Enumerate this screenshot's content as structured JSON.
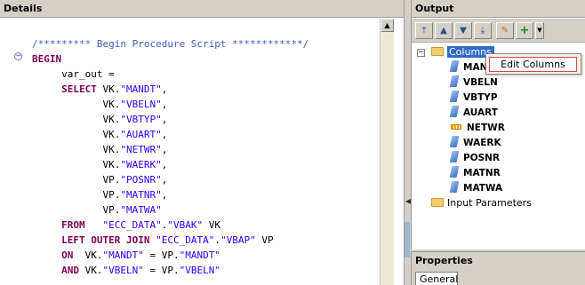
{
  "details": {
    "title": "Details",
    "code_lines": [
      [
        {
          "t": "/********* Begin Procedure Script ************/",
          "c": "cmt"
        }
      ],
      [
        {
          "t": "BEGIN",
          "c": "kw"
        }
      ],
      [
        {
          "t": "     var_out ="
        }
      ],
      [
        {
          "t": "     "
        },
        {
          "t": "SELECT",
          "c": "kw"
        },
        {
          "t": " VK."
        },
        {
          "t": "\"MANDT\"",
          "c": "str"
        },
        {
          "t": ","
        }
      ],
      [
        {
          "t": "            VK."
        },
        {
          "t": "\"VBELN\"",
          "c": "str"
        },
        {
          "t": ","
        }
      ],
      [
        {
          "t": "            VK."
        },
        {
          "t": "\"VBTYP\"",
          "c": "str"
        },
        {
          "t": ","
        }
      ],
      [
        {
          "t": "            VK."
        },
        {
          "t": "\"AUART\"",
          "c": "str"
        },
        {
          "t": ","
        }
      ],
      [
        {
          "t": "            VK."
        },
        {
          "t": "\"NETWR\"",
          "c": "str"
        },
        {
          "t": ","
        }
      ],
      [
        {
          "t": "            VK."
        },
        {
          "t": "\"WAERK\"",
          "c": "str"
        },
        {
          "t": ","
        }
      ],
      [
        {
          "t": "            VP."
        },
        {
          "t": "\"POSNR\"",
          "c": "str"
        },
        {
          "t": ","
        }
      ],
      [
        {
          "t": "            VP."
        },
        {
          "t": "\"MATNR\"",
          "c": "str"
        },
        {
          "t": ","
        }
      ],
      [
        {
          "t": "            VP."
        },
        {
          "t": "\"MATWA\"",
          "c": "str"
        }
      ],
      [
        {
          "t": "     "
        },
        {
          "t": "FROM",
          "c": "kw"
        },
        {
          "t": "   "
        },
        {
          "t": "\"ECC_DATA\"",
          "c": "str"
        },
        {
          "t": "."
        },
        {
          "t": "\"VBAK\"",
          "c": "str"
        },
        {
          "t": " VK"
        }
      ],
      [
        {
          "t": "     "
        },
        {
          "t": "LEFT OUTER JOIN",
          "c": "kw"
        },
        {
          "t": " "
        },
        {
          "t": "\"ECC_DATA\"",
          "c": "str"
        },
        {
          "t": "."
        },
        {
          "t": "\"VBAP\"",
          "c": "str"
        },
        {
          "t": " VP"
        }
      ],
      [
        {
          "t": "     "
        },
        {
          "t": "ON",
          "c": "kw"
        },
        {
          "t": "  VK."
        },
        {
          "t": "\"MANDT\"",
          "c": "str"
        },
        {
          "t": " = VP."
        },
        {
          "t": "\"MANDT\"",
          "c": "str"
        }
      ],
      [
        {
          "t": "     "
        },
        {
          "t": "AND",
          "c": "kw"
        },
        {
          "t": " VK."
        },
        {
          "t": "\"VBELN\"",
          "c": "str"
        },
        {
          "t": " = VP."
        },
        {
          "t": "\"VBELN\"",
          "c": "str"
        }
      ]
    ]
  },
  "output": {
    "title": "Output",
    "toolbar": [
      "move-top-icon",
      "move-up-icon",
      "move-down-icon",
      "move-bottom-icon",
      "pencil-icon",
      "add-icon",
      "dropdown-arrow-icon"
    ],
    "columns_node": {
      "label": "Columns",
      "expander": "−"
    },
    "columns": [
      {
        "label": "MANDT",
        "icon": "attribute-icon"
      },
      {
        "label": "VBELN",
        "icon": "attribute-icon"
      },
      {
        "label": "VBTYP",
        "icon": "attribute-icon"
      },
      {
        "label": "AUART",
        "icon": "attribute-icon"
      },
      {
        "label": "NETWR",
        "icon": "measure-icon"
      },
      {
        "label": "WAERK",
        "icon": "attribute-icon"
      },
      {
        "label": "POSNR",
        "icon": "attribute-icon"
      },
      {
        "label": "MATNR",
        "icon": "attribute-icon"
      },
      {
        "label": "MATWA",
        "icon": "attribute-icon"
      }
    ],
    "input_params_node": {
      "label": "Input Parameters"
    }
  },
  "context_menu": {
    "item": "Edit Columns"
  },
  "properties": {
    "title": "Properties",
    "tab": "General"
  },
  "colors": {
    "keyword": "#7f0055",
    "string": "#2a00ff",
    "comment": "#3f5fbf",
    "selection": "#316ac5"
  }
}
